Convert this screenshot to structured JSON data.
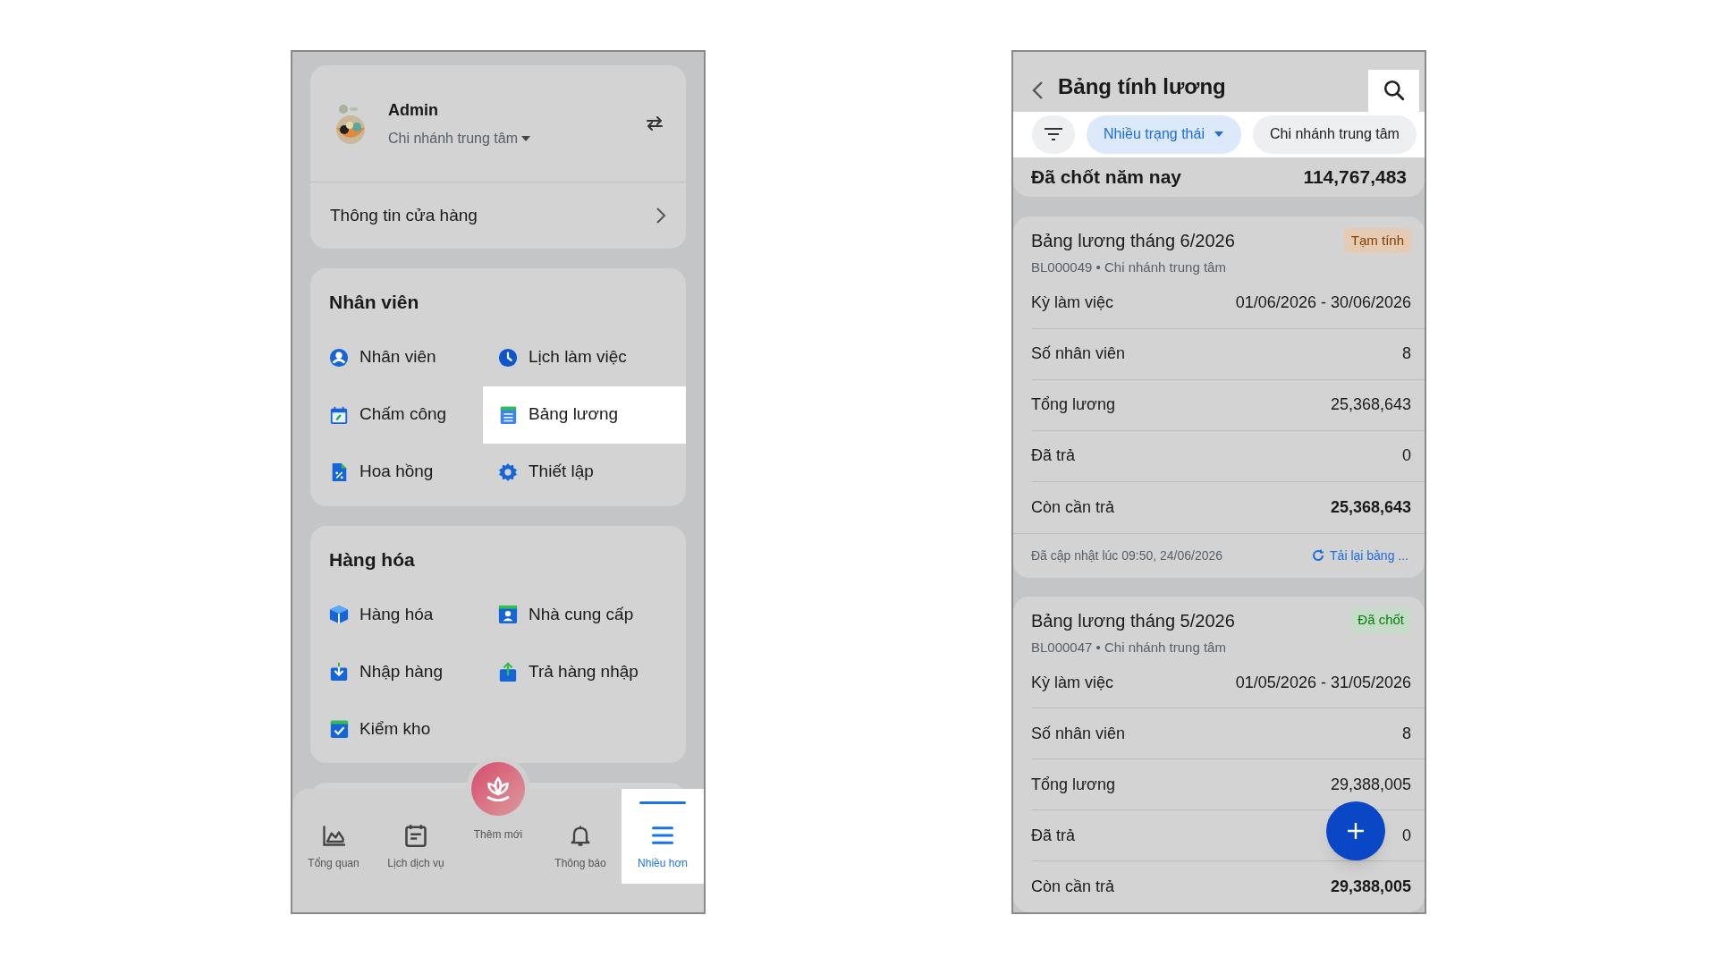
{
  "left_screen": {
    "profile": {
      "name": "Admin",
      "branch": "Chi nhánh trung tâm"
    },
    "store_info": "Thông tin cửa hàng",
    "sections": [
      {
        "title": "Nhân viên",
        "items": [
          {
            "label": "Nhân viên",
            "highlighted": false
          },
          {
            "label": "Lịch làm việc",
            "highlighted": false
          },
          {
            "label": "Chấm công",
            "highlighted": false
          },
          {
            "label": "Bảng lương",
            "highlighted": true
          },
          {
            "label": "Hoa hồng",
            "highlighted": false
          },
          {
            "label": "Thiết lập",
            "highlighted": false
          }
        ]
      },
      {
        "title": "Hàng hóa",
        "items": [
          {
            "label": "Hàng hóa",
            "highlighted": false
          },
          {
            "label": "Nhà cung cấp",
            "highlighted": false
          },
          {
            "label": "Nhập hàng",
            "highlighted": false
          },
          {
            "label": "Trả hàng nhập",
            "highlighted": false
          },
          {
            "label": "Kiểm kho",
            "highlighted": false
          }
        ]
      }
    ],
    "bottom_nav": [
      {
        "label": "Tổng quan",
        "kind": "tab",
        "selected": false
      },
      {
        "label": "Lịch dịch vụ",
        "kind": "tab",
        "selected": false
      },
      {
        "label": "Thêm mới",
        "kind": "fab",
        "selected": false
      },
      {
        "label": "Thông báo",
        "kind": "tab",
        "selected": false
      },
      {
        "label": "Nhiều hơn",
        "kind": "tab",
        "selected": true
      }
    ]
  },
  "right_screen": {
    "title": "Bảng tính lương",
    "filters": [
      {
        "label": "Nhiều trạng thái",
        "selected": true
      },
      {
        "label": "Chi nhánh trung tâm",
        "selected": false
      }
    ],
    "summary": {
      "label": "Đã chốt năm nay",
      "value": "114,767,483"
    },
    "payrolls": [
      {
        "title": "Bảng lương tháng 6/2026",
        "status": "Tạm tính",
        "color": "#e6cbb4",
        "subtitle": "BL000049 • Chi nhánh trung tâm",
        "rows": [
          {
            "label": "Kỳ làm việc",
            "value": "01/06/2026 - 30/06/2026",
            "emphasis": false
          },
          {
            "label": "Số nhân viên",
            "value": "8",
            "emphasis": false
          },
          {
            "label": "Tổng lương",
            "value": "25,368,643",
            "emphasis": false
          },
          {
            "label": "Đã trả",
            "value": "0",
            "emphasis": false
          },
          {
            "label": "Còn cần trả",
            "value": "25,368,643",
            "emphasis": true
          }
        ],
        "updated": "Đã cập nhật lúc 09:50, 24/06/2026",
        "reload": "Tải lại bảng ..."
      },
      {
        "title": "Bảng lương tháng 5/2026",
        "status": "Đã chốt",
        "color": "#c6dcc8",
        "subtitle": "BL000047 • Chi nhánh trung tâm",
        "rows": [
          {
            "label": "Kỳ làm việc",
            "value": "01/05/2026 - 31/05/2026",
            "emphasis": false
          },
          {
            "label": "Số nhân viên",
            "value": "8",
            "emphasis": false
          },
          {
            "label": "Tổng lương",
            "value": "29,388,005",
            "emphasis": false
          },
          {
            "label": "Đã trả",
            "value": "0",
            "emphasis": false
          },
          {
            "label": "Còn cần trả",
            "value": "29,388,005",
            "emphasis": true
          }
        ]
      }
    ]
  }
}
